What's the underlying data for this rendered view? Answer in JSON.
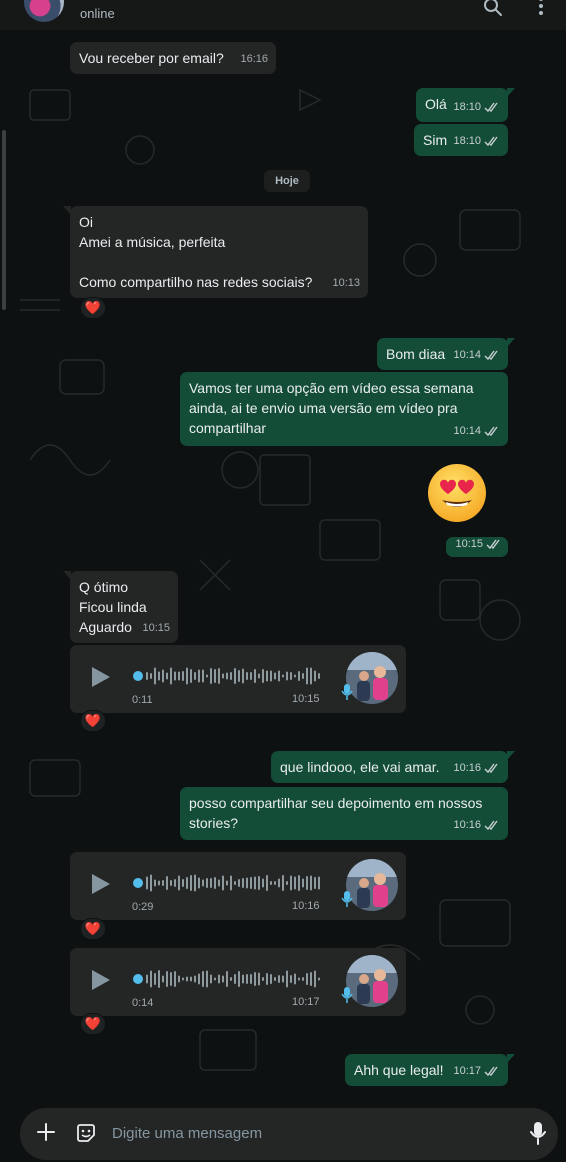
{
  "header": {
    "status": "online",
    "icons": [
      "search-icon",
      "menu-icon"
    ]
  },
  "day_divider": "Hoje",
  "messages": [
    {
      "id": "m1",
      "dir": "in",
      "text": "Vou receber por email?",
      "time": "16:16"
    },
    {
      "id": "m2",
      "dir": "out",
      "text": "Olá",
      "time": "18:10",
      "status": "read"
    },
    {
      "id": "m3",
      "dir": "out",
      "text": "Sim",
      "time": "18:10",
      "status": "read"
    },
    {
      "id": "m4",
      "dir": "in",
      "text": "Oi\nAmei a música, perfeita\n\nComo compartilho nas redes sociais?",
      "time": "10:13",
      "reaction": "❤️"
    },
    {
      "id": "m5",
      "dir": "out",
      "text": "Bom diaa",
      "time": "10:14",
      "status": "read"
    },
    {
      "id": "m6",
      "dir": "out",
      "text": "Vamos ter uma opção em vídeo essa semana\nainda, ai te envio uma versão em vídeo pra\ncompartilhar",
      "time": "10:14",
      "status": "read"
    },
    {
      "id": "m7",
      "dir": "out",
      "emoji": "smiling-face-with-heart-eyes",
      "time": "10:15",
      "status": "read"
    },
    {
      "id": "m8",
      "dir": "in",
      "text": "Q ótimo\nFicou linda\nAguardo",
      "time": "10:15"
    },
    {
      "id": "v1",
      "dir": "in",
      "type": "voice",
      "duration": "0:11",
      "time": "10:15",
      "reaction": "❤️"
    },
    {
      "id": "m9",
      "dir": "out",
      "text": "que lindooo, ele vai amar.",
      "time": "10:16",
      "status": "read"
    },
    {
      "id": "m10",
      "dir": "out",
      "text": "posso compartilhar seu depoimento em nossos\nstories?",
      "time": "10:16",
      "status": "read"
    },
    {
      "id": "v2",
      "dir": "in",
      "type": "voice",
      "duration": "0:29",
      "time": "10:16",
      "reaction": "❤️"
    },
    {
      "id": "v3",
      "dir": "in",
      "type": "voice",
      "duration": "0:14",
      "time": "10:17",
      "reaction": "❤️"
    },
    {
      "id": "m11",
      "dir": "out",
      "text": "Ahh que legal!",
      "time": "10:17",
      "status": "read"
    }
  ],
  "composer": {
    "placeholder": "Digite uma mensagem",
    "icons": [
      "plus-icon",
      "sticker-icon",
      "microphone-icon"
    ]
  },
  "colors": {
    "incoming": "#242626",
    "outgoing": "#144d37",
    "background": "#0d1112",
    "heart": "#e02646",
    "voice_dot": "#53bdeb"
  }
}
